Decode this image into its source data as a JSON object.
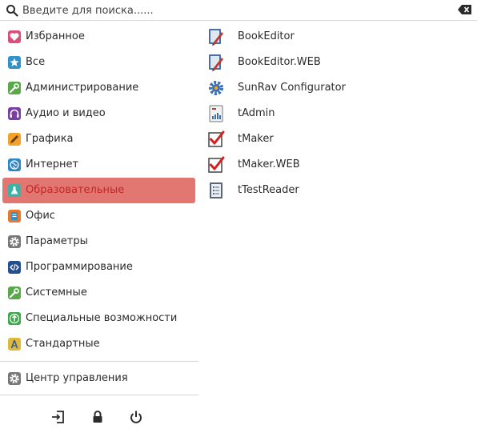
{
  "search": {
    "placeholder": "Введите для поиска......",
    "value": ""
  },
  "categories": [
    {
      "label": "Избранное",
      "icon": "heart-icon",
      "color": "#d94f7a"
    },
    {
      "label": "Все",
      "icon": "star-icon",
      "color": "#2f93c9"
    },
    {
      "label": "Администрирование",
      "icon": "wrench-icon",
      "color": "#5aa84a"
    },
    {
      "label": "Аудио и видео",
      "icon": "headphones-icon",
      "color": "#7a3fa2"
    },
    {
      "label": "Графика",
      "icon": "pencil-icon",
      "color": "#f2a12b"
    },
    {
      "label": "Интернет",
      "icon": "globe-icon",
      "color": "#2f86c4"
    },
    {
      "label": "Образовательные",
      "icon": "flask-icon",
      "color": "#3ab3a6",
      "active": true
    },
    {
      "label": "Офис",
      "icon": "document-icon",
      "color": "#e8782b"
    },
    {
      "label": "Параметры",
      "icon": "gear-icon",
      "color": "#777777"
    },
    {
      "label": "Программирование",
      "icon": "code-icon",
      "color": "#244f8f"
    },
    {
      "label": "Системные",
      "icon": "wrench-icon",
      "color": "#5aa84a"
    },
    {
      "label": "Специальные возможности",
      "icon": "accessibility-icon",
      "color": "#3aa84a"
    },
    {
      "label": "Стандартные",
      "icon": "compass-icon",
      "color": "#e0b83a"
    }
  ],
  "control_center": {
    "label": "Центр управления",
    "icon": "gear-icon"
  },
  "apps": [
    {
      "label": "BookEditor",
      "icon": "book-editor-icon"
    },
    {
      "label": "BookEditor.WEB",
      "icon": "book-editor-icon"
    },
    {
      "label": "SunRav Configurator",
      "icon": "gear-icon"
    },
    {
      "label": "tAdmin",
      "icon": "admin-chart-icon"
    },
    {
      "label": "tMaker",
      "icon": "checkmark-icon"
    },
    {
      "label": "tMaker.WEB",
      "icon": "checkmark-icon"
    },
    {
      "label": "tTestReader",
      "icon": "test-reader-icon"
    }
  ],
  "bottom_actions": [
    {
      "name": "logout",
      "icon": "logout-icon"
    },
    {
      "name": "lock",
      "icon": "lock-icon"
    },
    {
      "name": "power",
      "icon": "power-icon"
    }
  ],
  "colors": {
    "active_bg": "#e27671",
    "active_text": "#c0282a",
    "divider": "#d8d8d8"
  }
}
